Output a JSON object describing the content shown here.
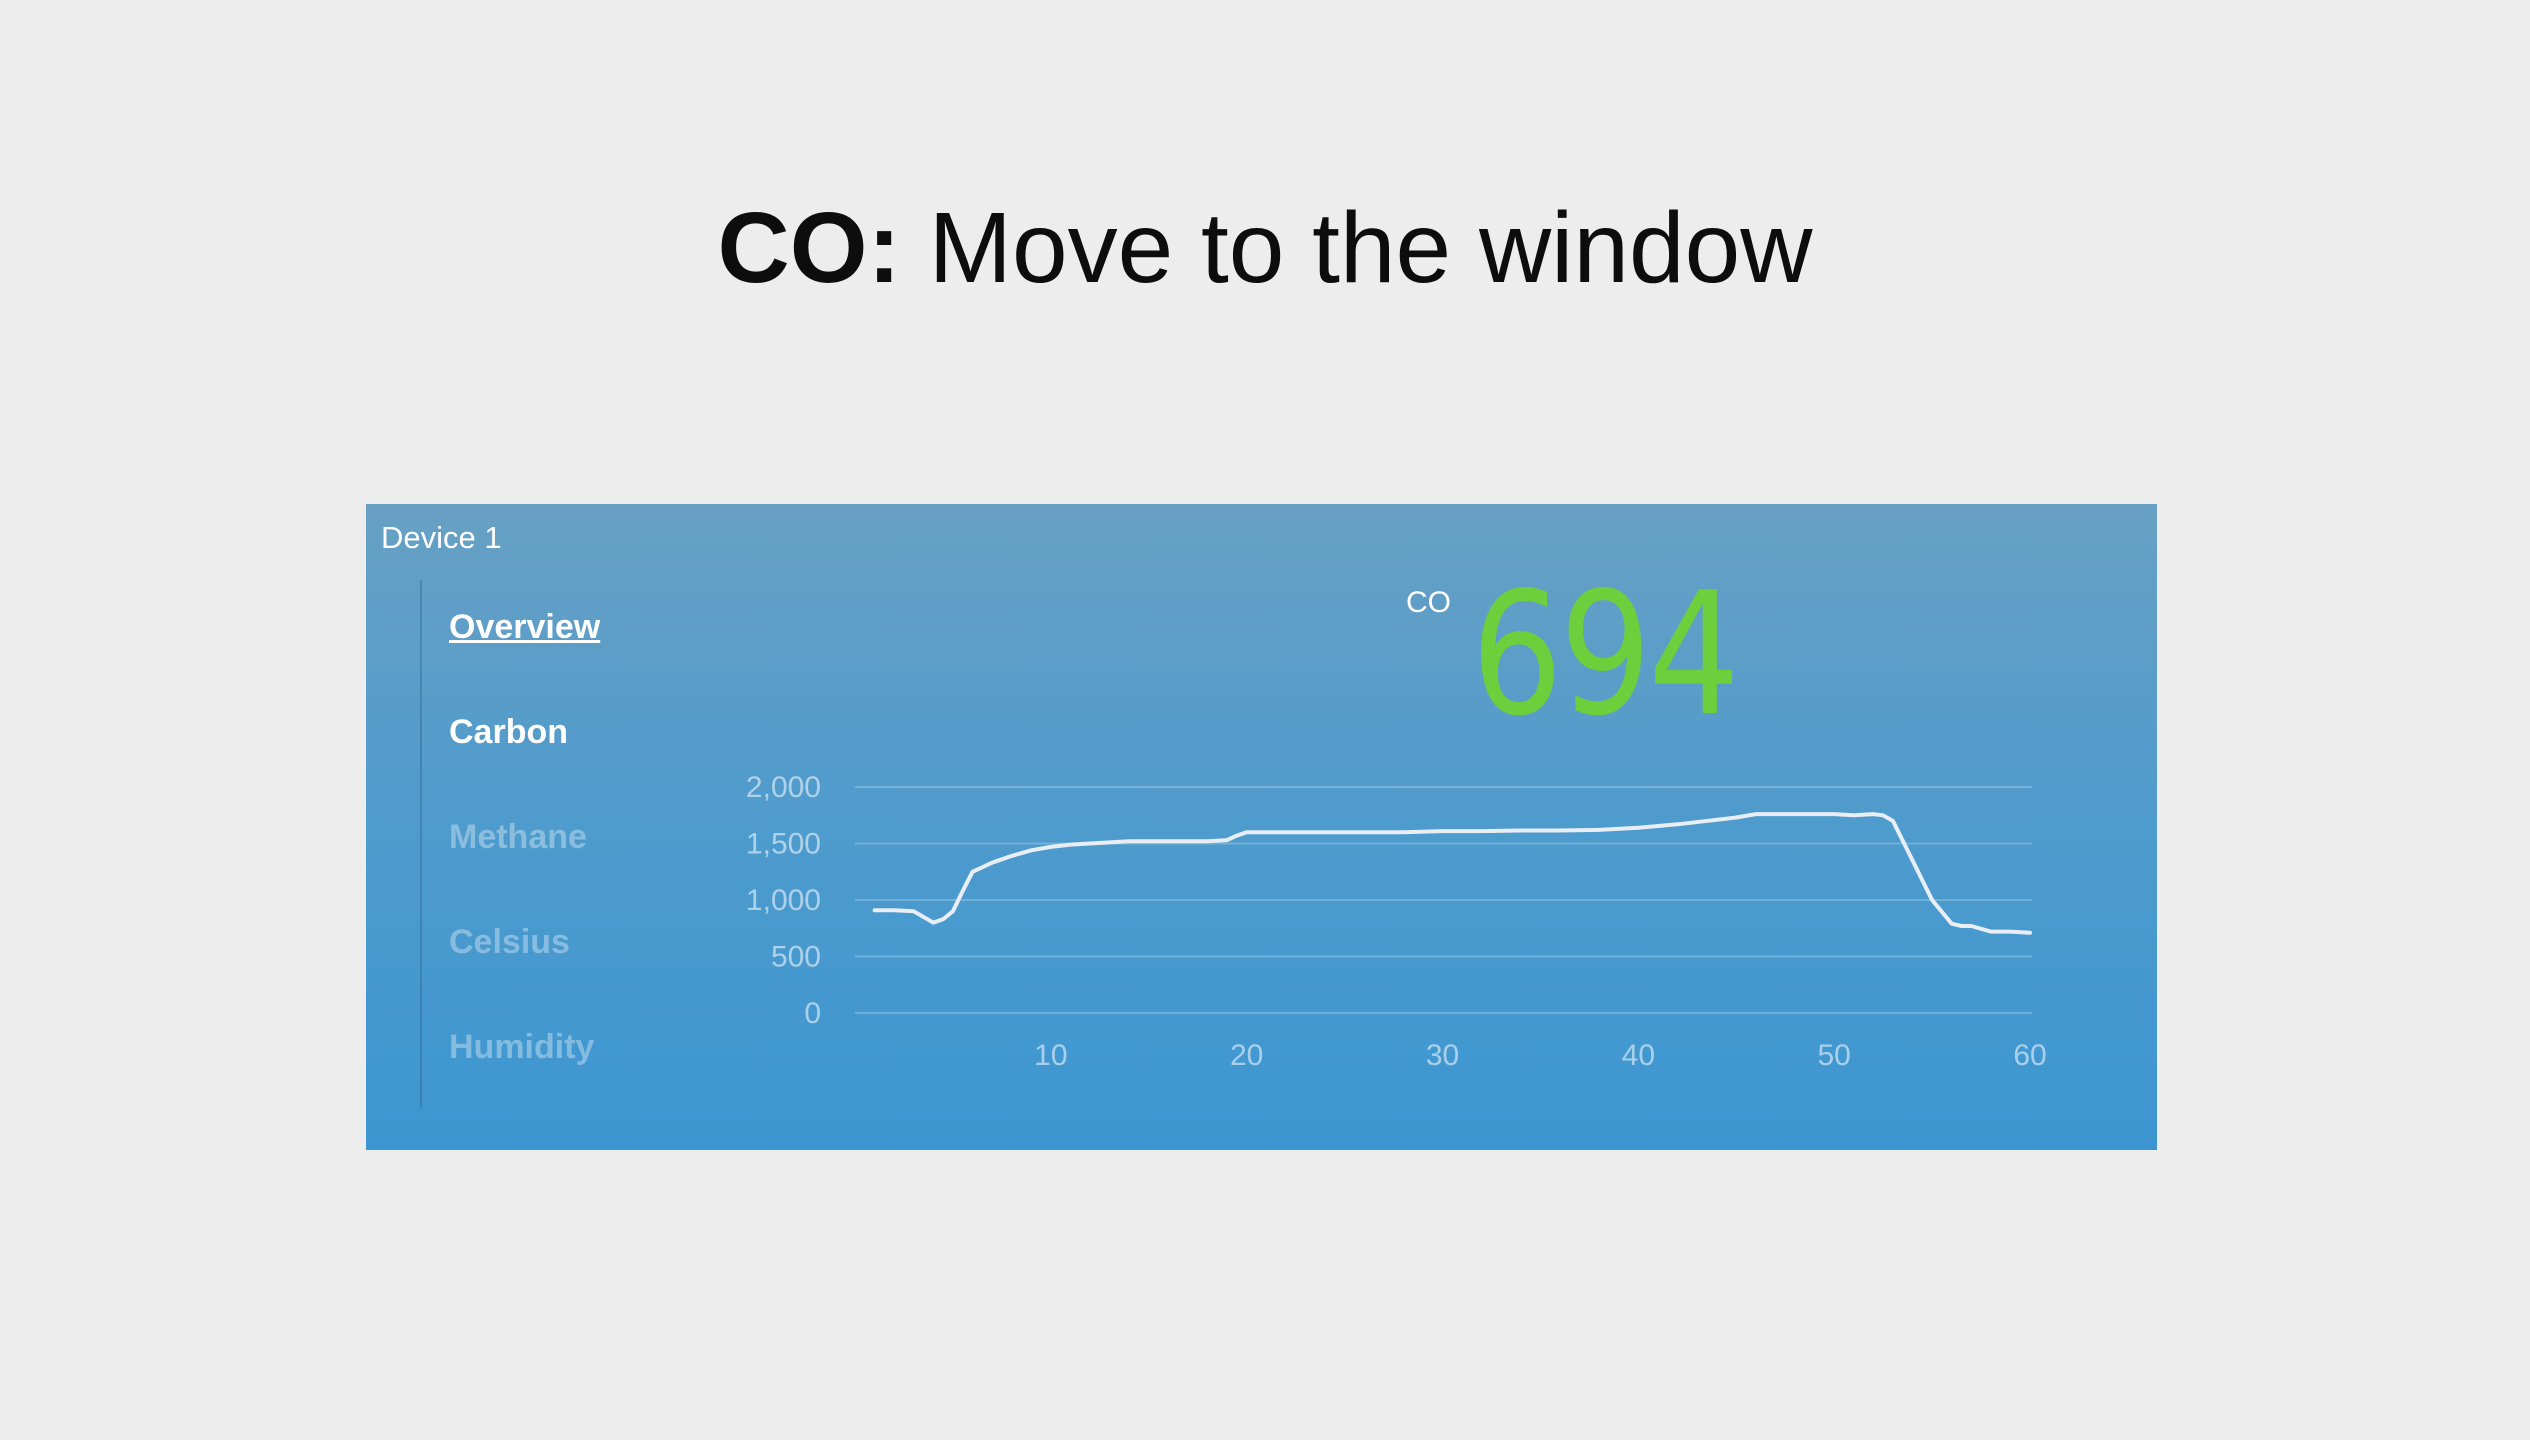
{
  "slide": {
    "title_bold": "CO:",
    "title_rest": "Move to the window"
  },
  "panel": {
    "device_title": "Device 1",
    "nav": [
      {
        "label": "Overview",
        "state": "active"
      },
      {
        "label": "Carbon",
        "state": "enabled"
      },
      {
        "label": "Methane",
        "state": "disabled"
      },
      {
        "label": "Celsius",
        "state": "disabled"
      },
      {
        "label": "Humidity",
        "state": "disabled"
      }
    ],
    "metric_label": "CO",
    "metric_value": "694",
    "metric_color": "#6ccf3b"
  },
  "chart_data": {
    "type": "line",
    "xlim": [
      0,
      60
    ],
    "ylim": [
      0,
      2000
    ],
    "x_ticks": [
      "10",
      "20",
      "30",
      "40",
      "50",
      "60"
    ],
    "y_ticks": [
      "2,000",
      "1,500",
      "1,000",
      "500",
      "0"
    ],
    "grid": true,
    "line_color": "#e8eef3",
    "series": [
      {
        "x": [
          1,
          2,
          3,
          4,
          4.5,
          5,
          5.5,
          6,
          7,
          8,
          9,
          10,
          11,
          12,
          13,
          14,
          15,
          16,
          17,
          18,
          19,
          19.5,
          20,
          22,
          24,
          26,
          28,
          30,
          32,
          34,
          36,
          38,
          40,
          42,
          44,
          45,
          46,
          48,
          50,
          51,
          52,
          52.5,
          53,
          54,
          55,
          56,
          56.5,
          57,
          58,
          59,
          60
        ],
        "y": [
          910,
          910,
          900,
          800,
          830,
          900,
          1080,
          1250,
          1330,
          1390,
          1440,
          1470,
          1490,
          1500,
          1510,
          1520,
          1520,
          1520,
          1520,
          1520,
          1530,
          1570,
          1600,
          1600,
          1600,
          1600,
          1600,
          1610,
          1610,
          1615,
          1615,
          1620,
          1640,
          1670,
          1710,
          1730,
          1760,
          1760,
          1760,
          1750,
          1760,
          1750,
          1700,
          1350,
          1000,
          790,
          770,
          770,
          720,
          720,
          710
        ]
      }
    ]
  }
}
